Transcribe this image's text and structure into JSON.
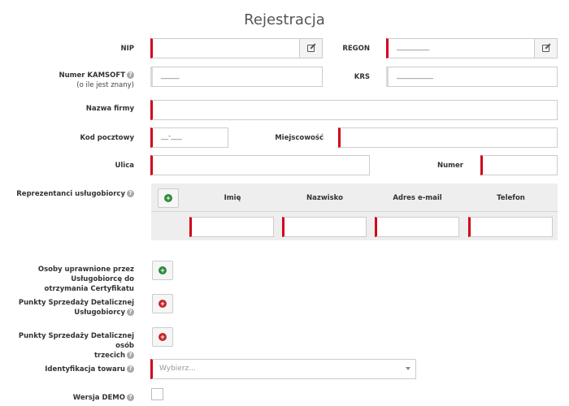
{
  "title": "Rejestracja",
  "fields": {
    "nip": {
      "label": "NIP"
    },
    "regon": {
      "label": "REGON",
      "mask": "_________"
    },
    "kamsoft": {
      "label": "Numer KAMSOFT",
      "sublabel": "(o ile jest znany)",
      "mask": "_____"
    },
    "krs": {
      "label": "KRS",
      "mask": "__________"
    },
    "nazwa": {
      "label": "Nazwa firmy"
    },
    "kod": {
      "label": "Kod pocztowy",
      "mask": "__-___"
    },
    "miejscowosc": {
      "label": "Miejscowość"
    },
    "ulica": {
      "label": "Ulica"
    },
    "numer": {
      "label": "Numer"
    }
  },
  "representatives": {
    "label": "Reprezentanci usługobiorcy",
    "columns": [
      "Imię",
      "Nazwisko",
      "Adres e-mail",
      "Telefon"
    ]
  },
  "sections": {
    "osoby": {
      "line1": "Osoby uprawnione przez Usługobiorcę do",
      "line2": "otrzymania Certyfikatu"
    },
    "punkty_uslugobiorcy": {
      "line1": "Punkty Sprzedaży Detalicznej",
      "line2": "Usługobiorcy"
    },
    "punkty_trzecich": {
      "line1": "Punkty Sprzedaży Detalicznej osób",
      "line2": "trzecich"
    }
  },
  "identyfikacja": {
    "label": "Identyfikacja towaru",
    "placeholder": "Wybierz..."
  },
  "demo": {
    "label": "Wersja DEMO",
    "checked": false
  },
  "colors": {
    "required": "#d0021b",
    "add": "#2e8b3d",
    "remove": "#c62828"
  },
  "icons": {
    "help": "question-circle-icon",
    "edit": "edit-icon",
    "add": "plus-circle-icon",
    "remove": "plus-circle-red-icon"
  }
}
